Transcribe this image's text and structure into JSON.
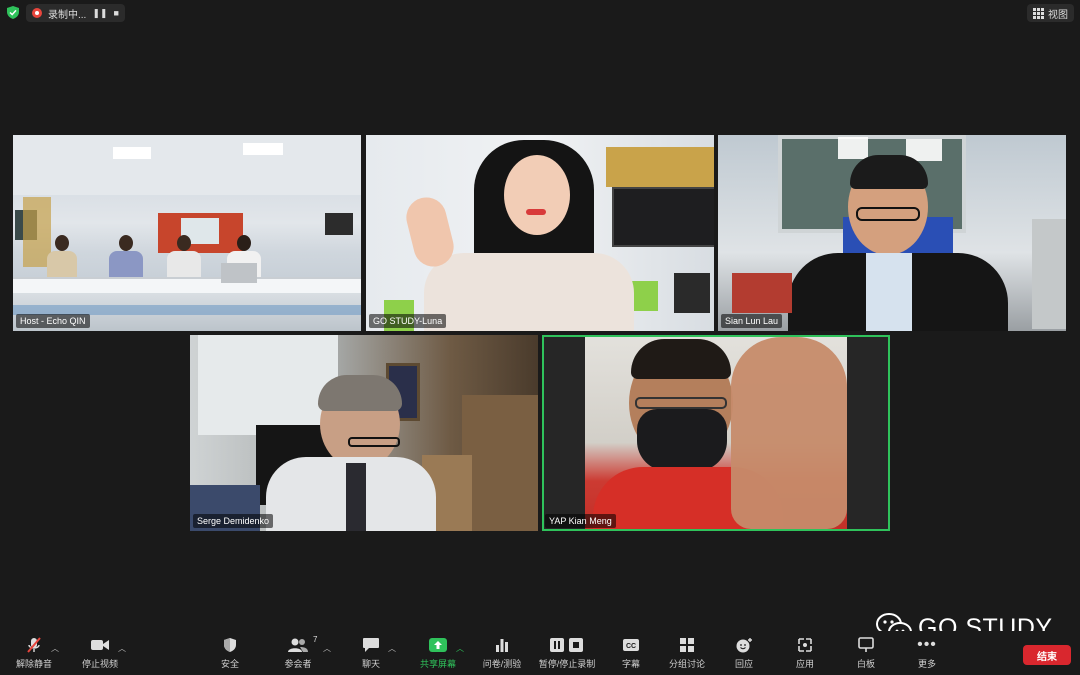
{
  "topbar": {
    "recording_label": "录制中...",
    "view_label": "视图"
  },
  "participants": [
    {
      "name": "Host - Echo QIN"
    },
    {
      "name": "GO STUDY-Luna"
    },
    {
      "name": "Sian Lun Lau"
    },
    {
      "name": "Serge Demidenko"
    },
    {
      "name": "YAP Kian Meng"
    }
  ],
  "participant_count": "7",
  "watermark": {
    "text": "GO STUDY"
  },
  "toolbar": {
    "unmute": "解除静音",
    "stop_video": "停止视频",
    "security": "安全",
    "participants": "参会者",
    "chat": "聊天",
    "share_screen": "共享屏幕",
    "polls": "问卷/测验",
    "pause_recording": "暂停/停止录制",
    "captions": "字幕",
    "breakout": "分组讨论",
    "reactions": "回应",
    "apps": "应用",
    "whiteboard": "白板",
    "more": "更多",
    "end": "结束"
  },
  "colors": {
    "background": "#1a1a1a",
    "active_speaker_border": "#2fc25b",
    "end_button": "#d9272e",
    "share_green": "#2fc25b"
  }
}
